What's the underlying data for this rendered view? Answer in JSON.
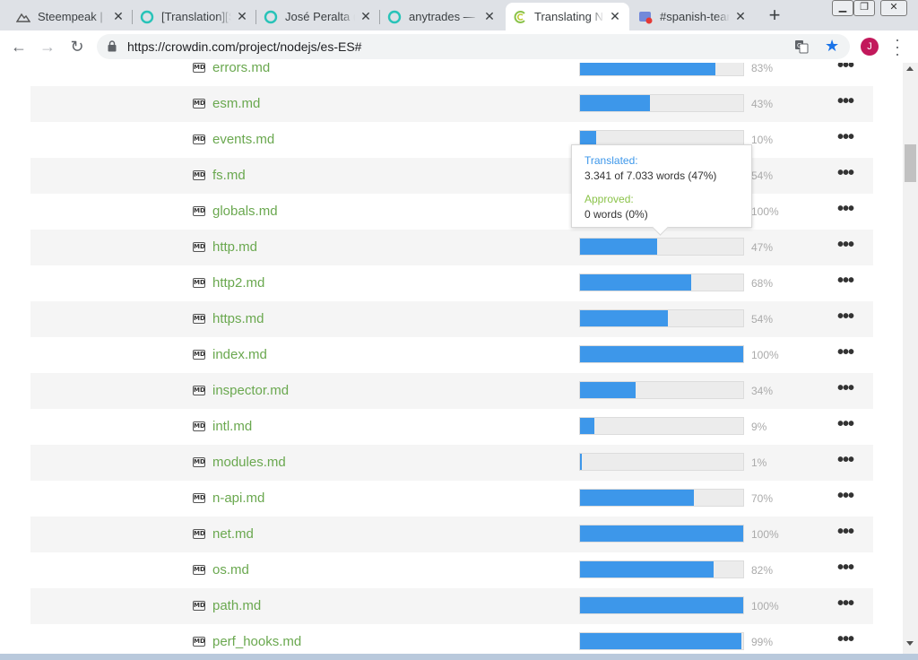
{
  "tabs": [
    {
      "title": "Steempeak | S",
      "icon": "steempeak-icon",
      "active": false
    },
    {
      "title": "[Translation][S",
      "icon": "utopian-icon",
      "active": false
    },
    {
      "title": "José Peralta (C",
      "icon": "utopian-icon",
      "active": false
    },
    {
      "title": "anytrades — S",
      "icon": "utopian-icon",
      "active": false
    },
    {
      "title": "Translating N",
      "icon": "crowdin-icon",
      "active": true
    },
    {
      "title": "#spanish-tean",
      "icon": "discord-icon",
      "active": false
    }
  ],
  "address_bar": {
    "url": "https://crowdin.com/project/nodejs/es-ES#",
    "avatar_letter": "J"
  },
  "files": [
    {
      "name": "errors.md",
      "progress": 83,
      "pct": "83%"
    },
    {
      "name": "esm.md",
      "progress": 43,
      "pct": "43%"
    },
    {
      "name": "events.md",
      "progress": 10,
      "pct": "10%"
    },
    {
      "name": "fs.md",
      "progress": 54,
      "pct": "54%"
    },
    {
      "name": "globals.md",
      "progress": 100,
      "pct": "100%"
    },
    {
      "name": "http.md",
      "progress": 47,
      "pct": "47%"
    },
    {
      "name": "http2.md",
      "progress": 68,
      "pct": "68%"
    },
    {
      "name": "https.md",
      "progress": 54,
      "pct": "54%"
    },
    {
      "name": "index.md",
      "progress": 100,
      "pct": "100%"
    },
    {
      "name": "inspector.md",
      "progress": 34,
      "pct": "34%"
    },
    {
      "name": "intl.md",
      "progress": 9,
      "pct": "9%"
    },
    {
      "name": "modules.md",
      "progress": 1,
      "pct": "1%"
    },
    {
      "name": "n-api.md",
      "progress": 70,
      "pct": "70%"
    },
    {
      "name": "net.md",
      "progress": 100,
      "pct": "100%"
    },
    {
      "name": "os.md",
      "progress": 82,
      "pct": "82%"
    },
    {
      "name": "path.md",
      "progress": 100,
      "pct": "100%"
    },
    {
      "name": "perf_hooks.md",
      "progress": 99,
      "pct": "99%"
    }
  ],
  "file_icon_text": "MD",
  "more_label": "•••",
  "tooltip": {
    "translated_label": "Translated:",
    "translated_value": "3.341 of 7.033 words (47%)",
    "approved_label": "Approved:",
    "approved_value": "0 words (0%)"
  },
  "colors": {
    "bar_fill": "#3d97ea",
    "file_name": "#6aa84f",
    "approved_label": "#8bc34a"
  }
}
